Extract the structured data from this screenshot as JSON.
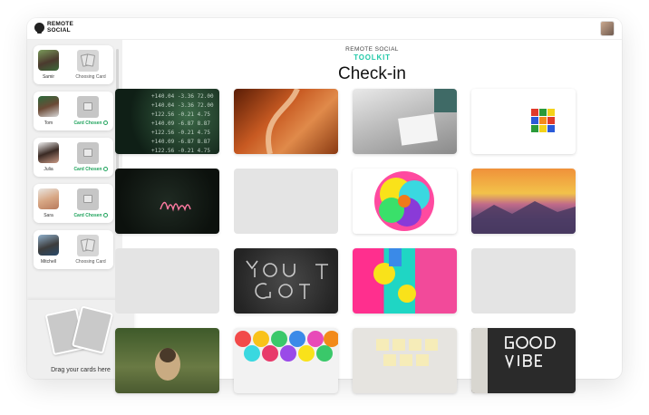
{
  "app": {
    "logo_text": "REMOTE SOCIAL",
    "brand": "REMOTE SOCIAL",
    "toolkit": "TOOLKIT",
    "title": "Check-in"
  },
  "players": [
    {
      "name": "Samir",
      "status": "Choosing Card",
      "chosen": false
    },
    {
      "name": "Tom",
      "status": "Card Chosen",
      "chosen": true
    },
    {
      "name": "Julia",
      "status": "Card Chosen",
      "chosen": true
    },
    {
      "name": "Sara",
      "status": "Card Chosen",
      "chosen": true
    },
    {
      "name": "Mitchell",
      "status": "Choosing Card",
      "chosen": false
    }
  ],
  "dropzone": {
    "label": "Drag your cards here"
  },
  "cards": [
    {
      "subject": "stock-ticker-photo",
      "theme": "dark-green"
    },
    {
      "subject": "orange-desert-road-photo",
      "theme": "orange"
    },
    {
      "subject": "book-on-bed-photo",
      "theme": "grey"
    },
    {
      "subject": "rubiks-cube-photo",
      "theme": "white"
    },
    {
      "subject": "neon-breathe-sign-photo",
      "theme": "dark"
    },
    {
      "subject": "empty-card",
      "theme": "blank"
    },
    {
      "subject": "rainbow-flower-photo",
      "theme": "multicolor"
    },
    {
      "subject": "sunset-mountains-photo",
      "theme": "sunset"
    },
    {
      "subject": "empty-card",
      "theme": "blank"
    },
    {
      "subject": "you-got-this-chalk-photo",
      "theme": "asphalt"
    },
    {
      "subject": "colorful-wall-photo",
      "theme": "multicolor"
    },
    {
      "subject": "empty-card",
      "theme": "blank"
    },
    {
      "subject": "pug-photo",
      "theme": "green"
    },
    {
      "subject": "colorful-umbrellas-photo",
      "theme": "multicolor"
    },
    {
      "subject": "sticky-notes-photo",
      "theme": "beige"
    },
    {
      "subject": "letterboard-photo",
      "theme": "dark"
    }
  ]
}
